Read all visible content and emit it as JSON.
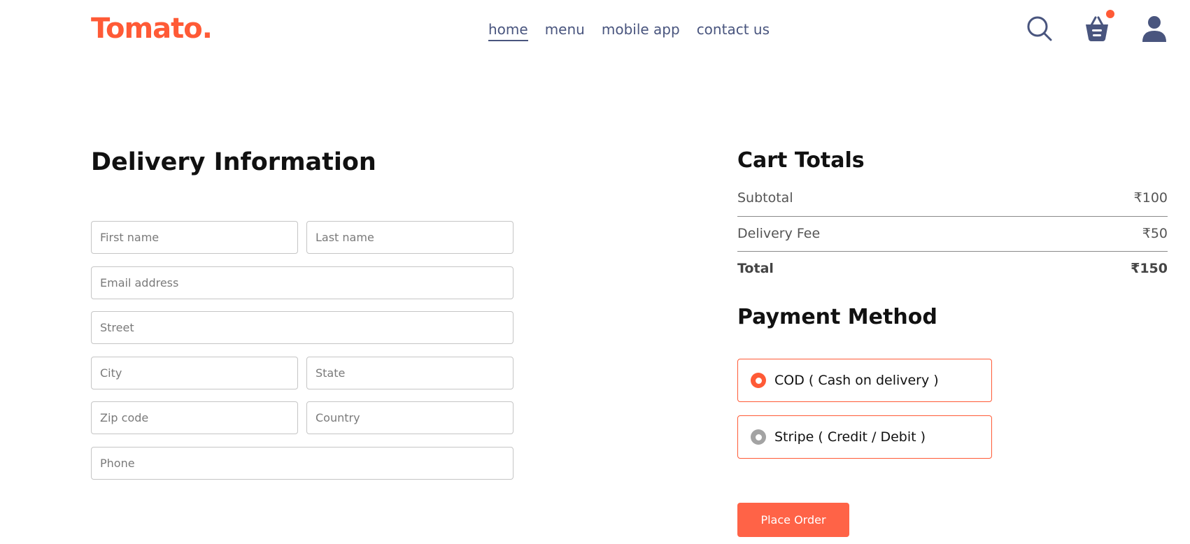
{
  "brand": {
    "logo_text": "Tomato.",
    "accent_color": "#ff5a36"
  },
  "nav": {
    "links": [
      {
        "label": "home",
        "active": true
      },
      {
        "label": "menu",
        "active": false
      },
      {
        "label": "mobile app",
        "active": false
      },
      {
        "label": "contact us",
        "active": false
      }
    ],
    "icons": [
      "search-icon",
      "basket-icon",
      "profile-icon"
    ],
    "cart_has_items": true
  },
  "delivery": {
    "title": "Delivery Information",
    "fields": {
      "first_name": "First name",
      "last_name": "Last name",
      "email": "Email address",
      "street": "Street",
      "city": "City",
      "state": "State",
      "zip": "Zip code",
      "country": "Country",
      "phone": "Phone"
    }
  },
  "cart": {
    "title": "Cart Totals",
    "subtotal_label": "Subtotal",
    "subtotal_value": "₹100",
    "delivery_label": "Delivery Fee",
    "delivery_value": "₹50",
    "total_label": "Total",
    "total_value": "₹150"
  },
  "payment": {
    "title": "Payment Method",
    "options": [
      {
        "label": "COD ( Cash on delivery )",
        "selected": true
      },
      {
        "label": "Stripe ( Credit / Debit )",
        "selected": false
      }
    ],
    "place_order_label": "Place Order"
  }
}
